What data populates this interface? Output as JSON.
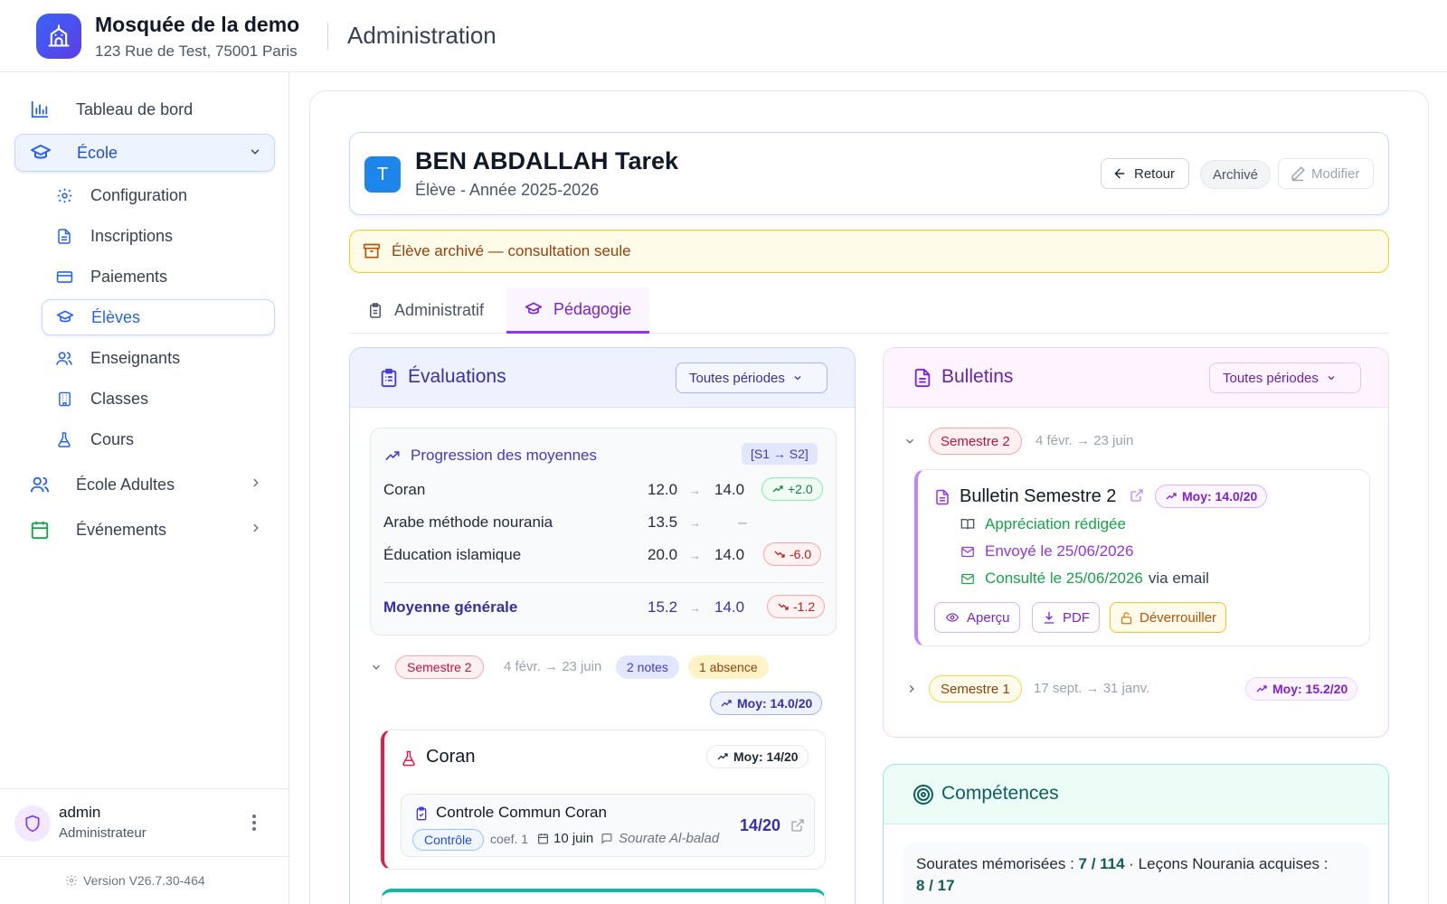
{
  "header": {
    "org_name": "Mosquée de la demo",
    "org_address": "123 Rue de Test, 75001 Paris",
    "section_title": "Administration"
  },
  "sidebar": {
    "dashboard": "Tableau de bord",
    "ecole": "École",
    "sub_items": [
      "Configuration",
      "Inscriptions",
      "Paiements",
      "Élèves",
      "Enseignants",
      "Classes",
      "Cours"
    ],
    "ecole_adultes": "École Adultes",
    "evenements": "Événements",
    "user": {
      "name": "admin",
      "role": "Administrateur"
    },
    "version": "Version V26.7.30-464"
  },
  "student": {
    "initial": "T",
    "name": "BEN ABDALLAH Tarek",
    "subtitle": "Élève - Année 2025-2026",
    "btn_back": "Retour",
    "badge_archived": "Archivé",
    "btn_edit": "Modifier"
  },
  "alert": {
    "text": "Élève archivé — consultation seule"
  },
  "tabs": {
    "administratif": "Administratif",
    "pedagogie": "Pédagogie",
    "active": "pedagogie"
  },
  "evaluations": {
    "title": "Évaluations",
    "filter": "Toutes périodes",
    "progression": {
      "title": "Progression des moyennes",
      "tag": "[S1 → S2]",
      "arrow": "→",
      "rows": [
        {
          "label": "Coran",
          "s1": "12.0",
          "s2": "14.0",
          "delta": "+2.0"
        },
        {
          "label": "Arabe méthode nourania",
          "s1": "13.5",
          "s2": "–",
          "delta": ""
        },
        {
          "label": "Éducation islamique",
          "s1": "20.0",
          "s2": "14.0",
          "delta": "-6.0"
        }
      ],
      "total": {
        "label": "Moyenne générale",
        "s1": "15.2",
        "s2": "14.0",
        "delta": "-1.2"
      }
    },
    "semester": {
      "label": "Semestre 2",
      "dates": "4 févr. → 23 juin",
      "notes": "2 notes",
      "absences": "1 absence",
      "moy": "Moy: 14.0/20"
    },
    "course": {
      "name": "Coran",
      "moy": "Moy: 14/20",
      "evaluation": {
        "title": "Controle Commun Coran",
        "type": "Contrôle",
        "coef": "coef. 1",
        "date": "10 juin",
        "comment": "Sourate Al-balad",
        "score": "14/20"
      }
    }
  },
  "bulletins": {
    "title": "Bulletins",
    "filter": "Toutes périodes",
    "s2": {
      "label": "Semestre 2",
      "dates": "4 févr. → 23 juin",
      "bulletin_title": "Bulletin Semestre 2",
      "moy": "Moy: 14.0/20",
      "appreciation": "Appréciation rédigée",
      "sent": "Envoyé le 25/06/2026",
      "consulted": "Consulté le 25/06/2026",
      "via": "via email",
      "btn_preview": "Aperçu",
      "btn_pdf": "PDF",
      "btn_unlock": "Déverrouiller"
    },
    "s1": {
      "label": "Semestre 1",
      "dates": "17 sept. → 31 janv.",
      "moy": "Moy: 15.2/20"
    }
  },
  "competences": {
    "title": "Compétences",
    "line1_a": "Sourates mémorisées : ",
    "line1_b": "7 / 114",
    "line1_c": " · Leçons Nourania acquises :",
    "line2": "8 / 17"
  },
  "colors": {
    "primary": "#2563eb",
    "purple": "#9333ea",
    "warning": "#facc15",
    "teal": "#14b8a6",
    "danger": "#e11d48"
  }
}
